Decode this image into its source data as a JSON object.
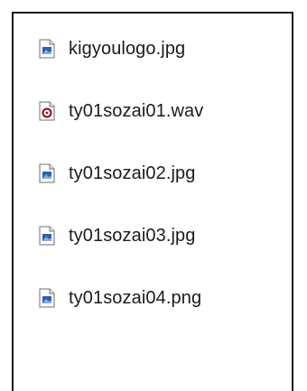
{
  "files": [
    {
      "name": "kigyoulogo.jpg",
      "icon": "image-file-icon"
    },
    {
      "name": "ty01sozai01.wav",
      "icon": "audio-file-icon"
    },
    {
      "name": "ty01sozai02.jpg",
      "icon": "image-file-icon"
    },
    {
      "name": "ty01sozai03.jpg",
      "icon": "image-file-icon"
    },
    {
      "name": "ty01sozai04.png",
      "icon": "image-file-icon"
    }
  ],
  "colors": {
    "image_icon_fill": "#2f5fb3",
    "audio_icon_ring": "#8a1f2b",
    "icon_border": "#6e6e6e"
  }
}
